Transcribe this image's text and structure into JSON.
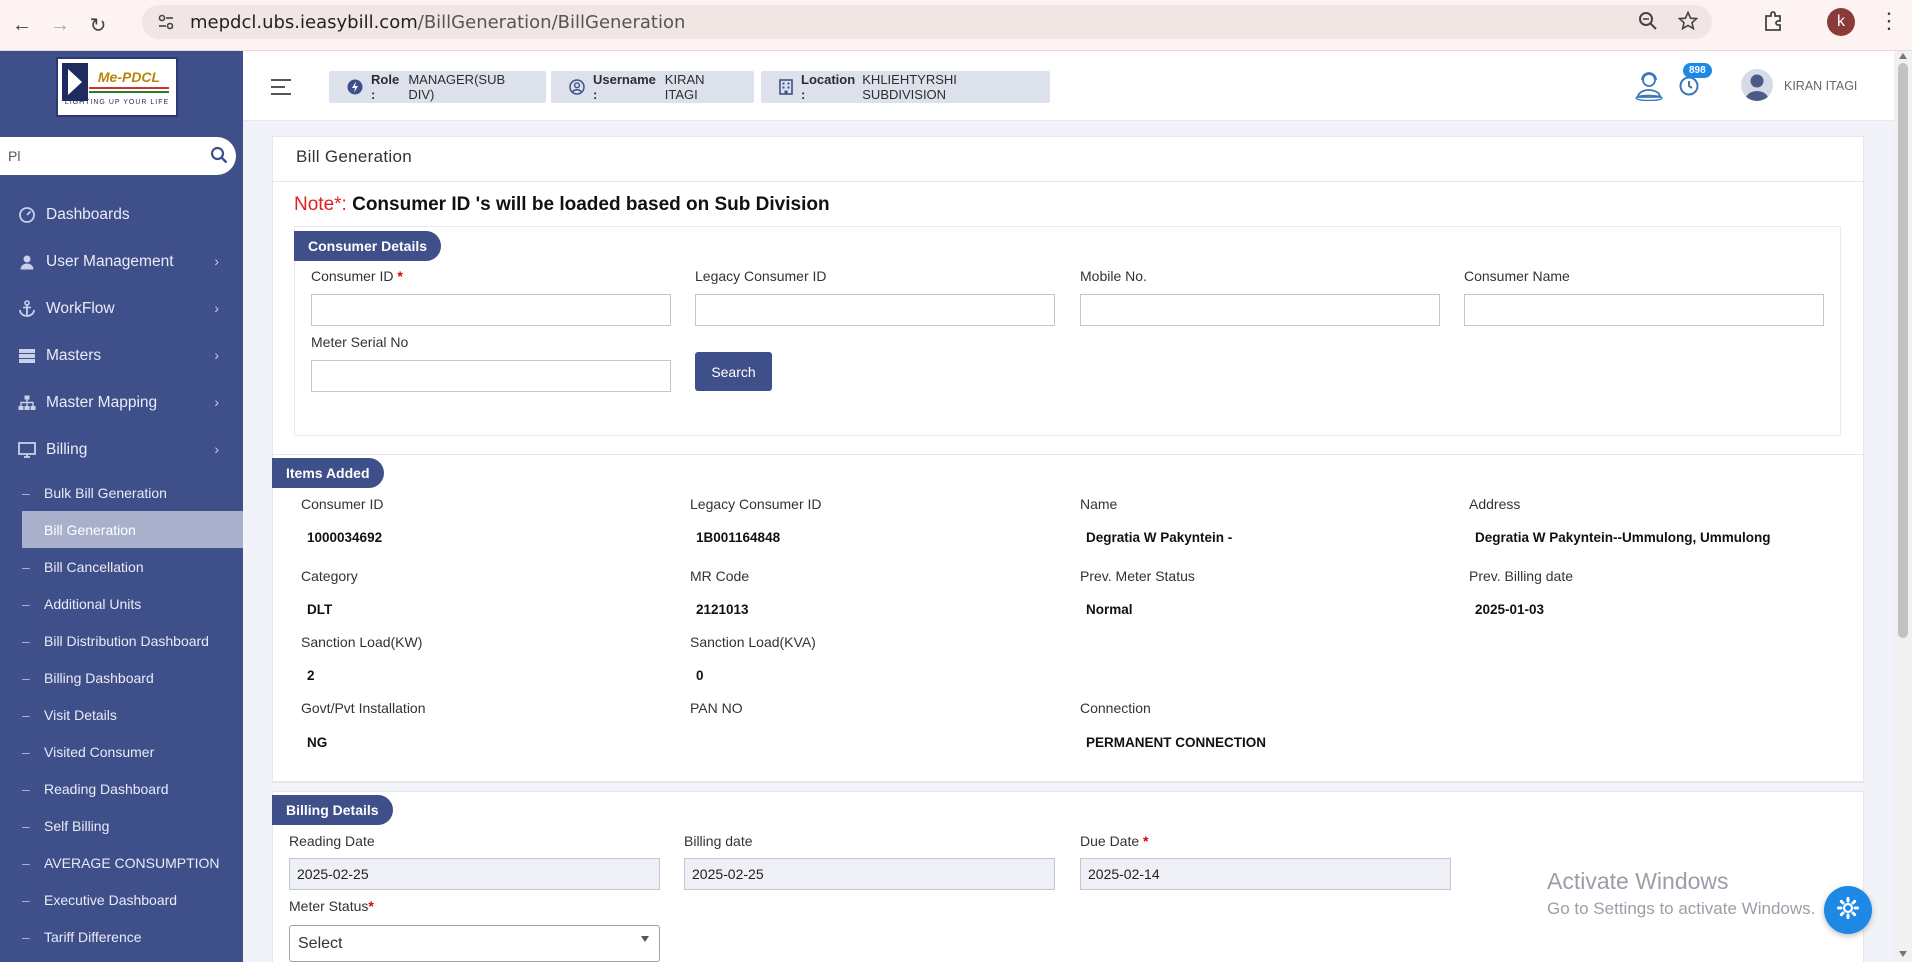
{
  "browser": {
    "url_host": "mepdcl.ubs.ieasybill.com",
    "url_path": "/BillGeneration/BillGeneration",
    "profile_initial": "k"
  },
  "sidebar": {
    "logo_brand": "Me-PDCL",
    "logo_tagline": "LIGHTING UP YOUR LIFE",
    "search_value": "Pl",
    "items": [
      {
        "label": "Dashboards",
        "icon": "dashboard-icon"
      },
      {
        "label": "User Management",
        "icon": "user-icon"
      },
      {
        "label": "WorkFlow",
        "icon": "anchor-icon"
      },
      {
        "label": "Masters",
        "icon": "server-icon"
      },
      {
        "label": "Master Mapping",
        "icon": "sitemap-icon"
      },
      {
        "label": "Billing",
        "icon": "monitor-icon"
      }
    ],
    "billing_subitems": [
      "Bulk Bill Generation",
      "Bill Generation",
      "Bill Cancellation",
      "Additional Units",
      "Bill Distribution Dashboard",
      "Billing Dashboard",
      "Visit Details",
      "Visited Consumer",
      "Reading Dashboard",
      "Self Billing",
      "AVERAGE CONSUMPTION",
      "Executive Dashboard",
      "Tariff Difference"
    ],
    "active_subitem": "Bill Generation"
  },
  "header": {
    "role_label": "Role :",
    "role_value": "MANAGER(SUB DIV)",
    "username_label": "Username :",
    "username_value": "KIRAN ITAGI",
    "location_label": "Location :",
    "location_value": "KHLIEHTYRSHI SUBDIVISION",
    "notification_count": "898",
    "user_name": "KIRAN ITAGI"
  },
  "page": {
    "title": "Bill Generation",
    "note_prefix": "Note*:",
    "note_text": " Consumer ID 's will be loaded based on Sub Division"
  },
  "consumer_details": {
    "section_label": "Consumer Details",
    "consumer_id_label": "Consumer ID",
    "legacy_id_label": "Legacy Consumer ID",
    "mobile_label": "Mobile No.",
    "name_label": "Consumer Name",
    "meter_serial_label": "Meter Serial No",
    "search_button": "Search"
  },
  "items_added": {
    "section_label": "Items Added",
    "fields": [
      {
        "label": "Consumer ID",
        "value": "1000034692"
      },
      {
        "label": "Legacy Consumer ID",
        "value": "1B001164848"
      },
      {
        "label": "Name",
        "value": "Degratia W Pakyntein -"
      },
      {
        "label": "Address",
        "value": "Degratia W Pakyntein--Ummulong, Ummulong"
      },
      {
        "label": "Category",
        "value": "DLT"
      },
      {
        "label": "MR Code",
        "value": "2121013"
      },
      {
        "label": "Prev. Meter Status",
        "value": "Normal"
      },
      {
        "label": "Prev. Billing date",
        "value": "2025-01-03"
      },
      {
        "label": "Sanction Load(KW)",
        "value": "2"
      },
      {
        "label": "Sanction Load(KVA)",
        "value": "0"
      },
      {
        "label": "Govt/Pvt Installation",
        "value": "NG"
      },
      {
        "label": "PAN NO",
        "value": ""
      },
      {
        "label": "Connection",
        "value": "PERMANENT CONNECTION"
      }
    ]
  },
  "billing_details": {
    "section_label": "Billing Details",
    "reading_date_label": "Reading Date",
    "reading_date_value": "2025-02-25",
    "billing_date_label": "Billing date",
    "billing_date_value": "2025-02-25",
    "due_date_label": "Due Date",
    "due_date_value": "2025-02-14",
    "meter_status_label": "Meter Status",
    "meter_status_value": "Select"
  },
  "watermark": {
    "line1": "Activate Windows",
    "line2": "Go to Settings to activate Windows."
  }
}
